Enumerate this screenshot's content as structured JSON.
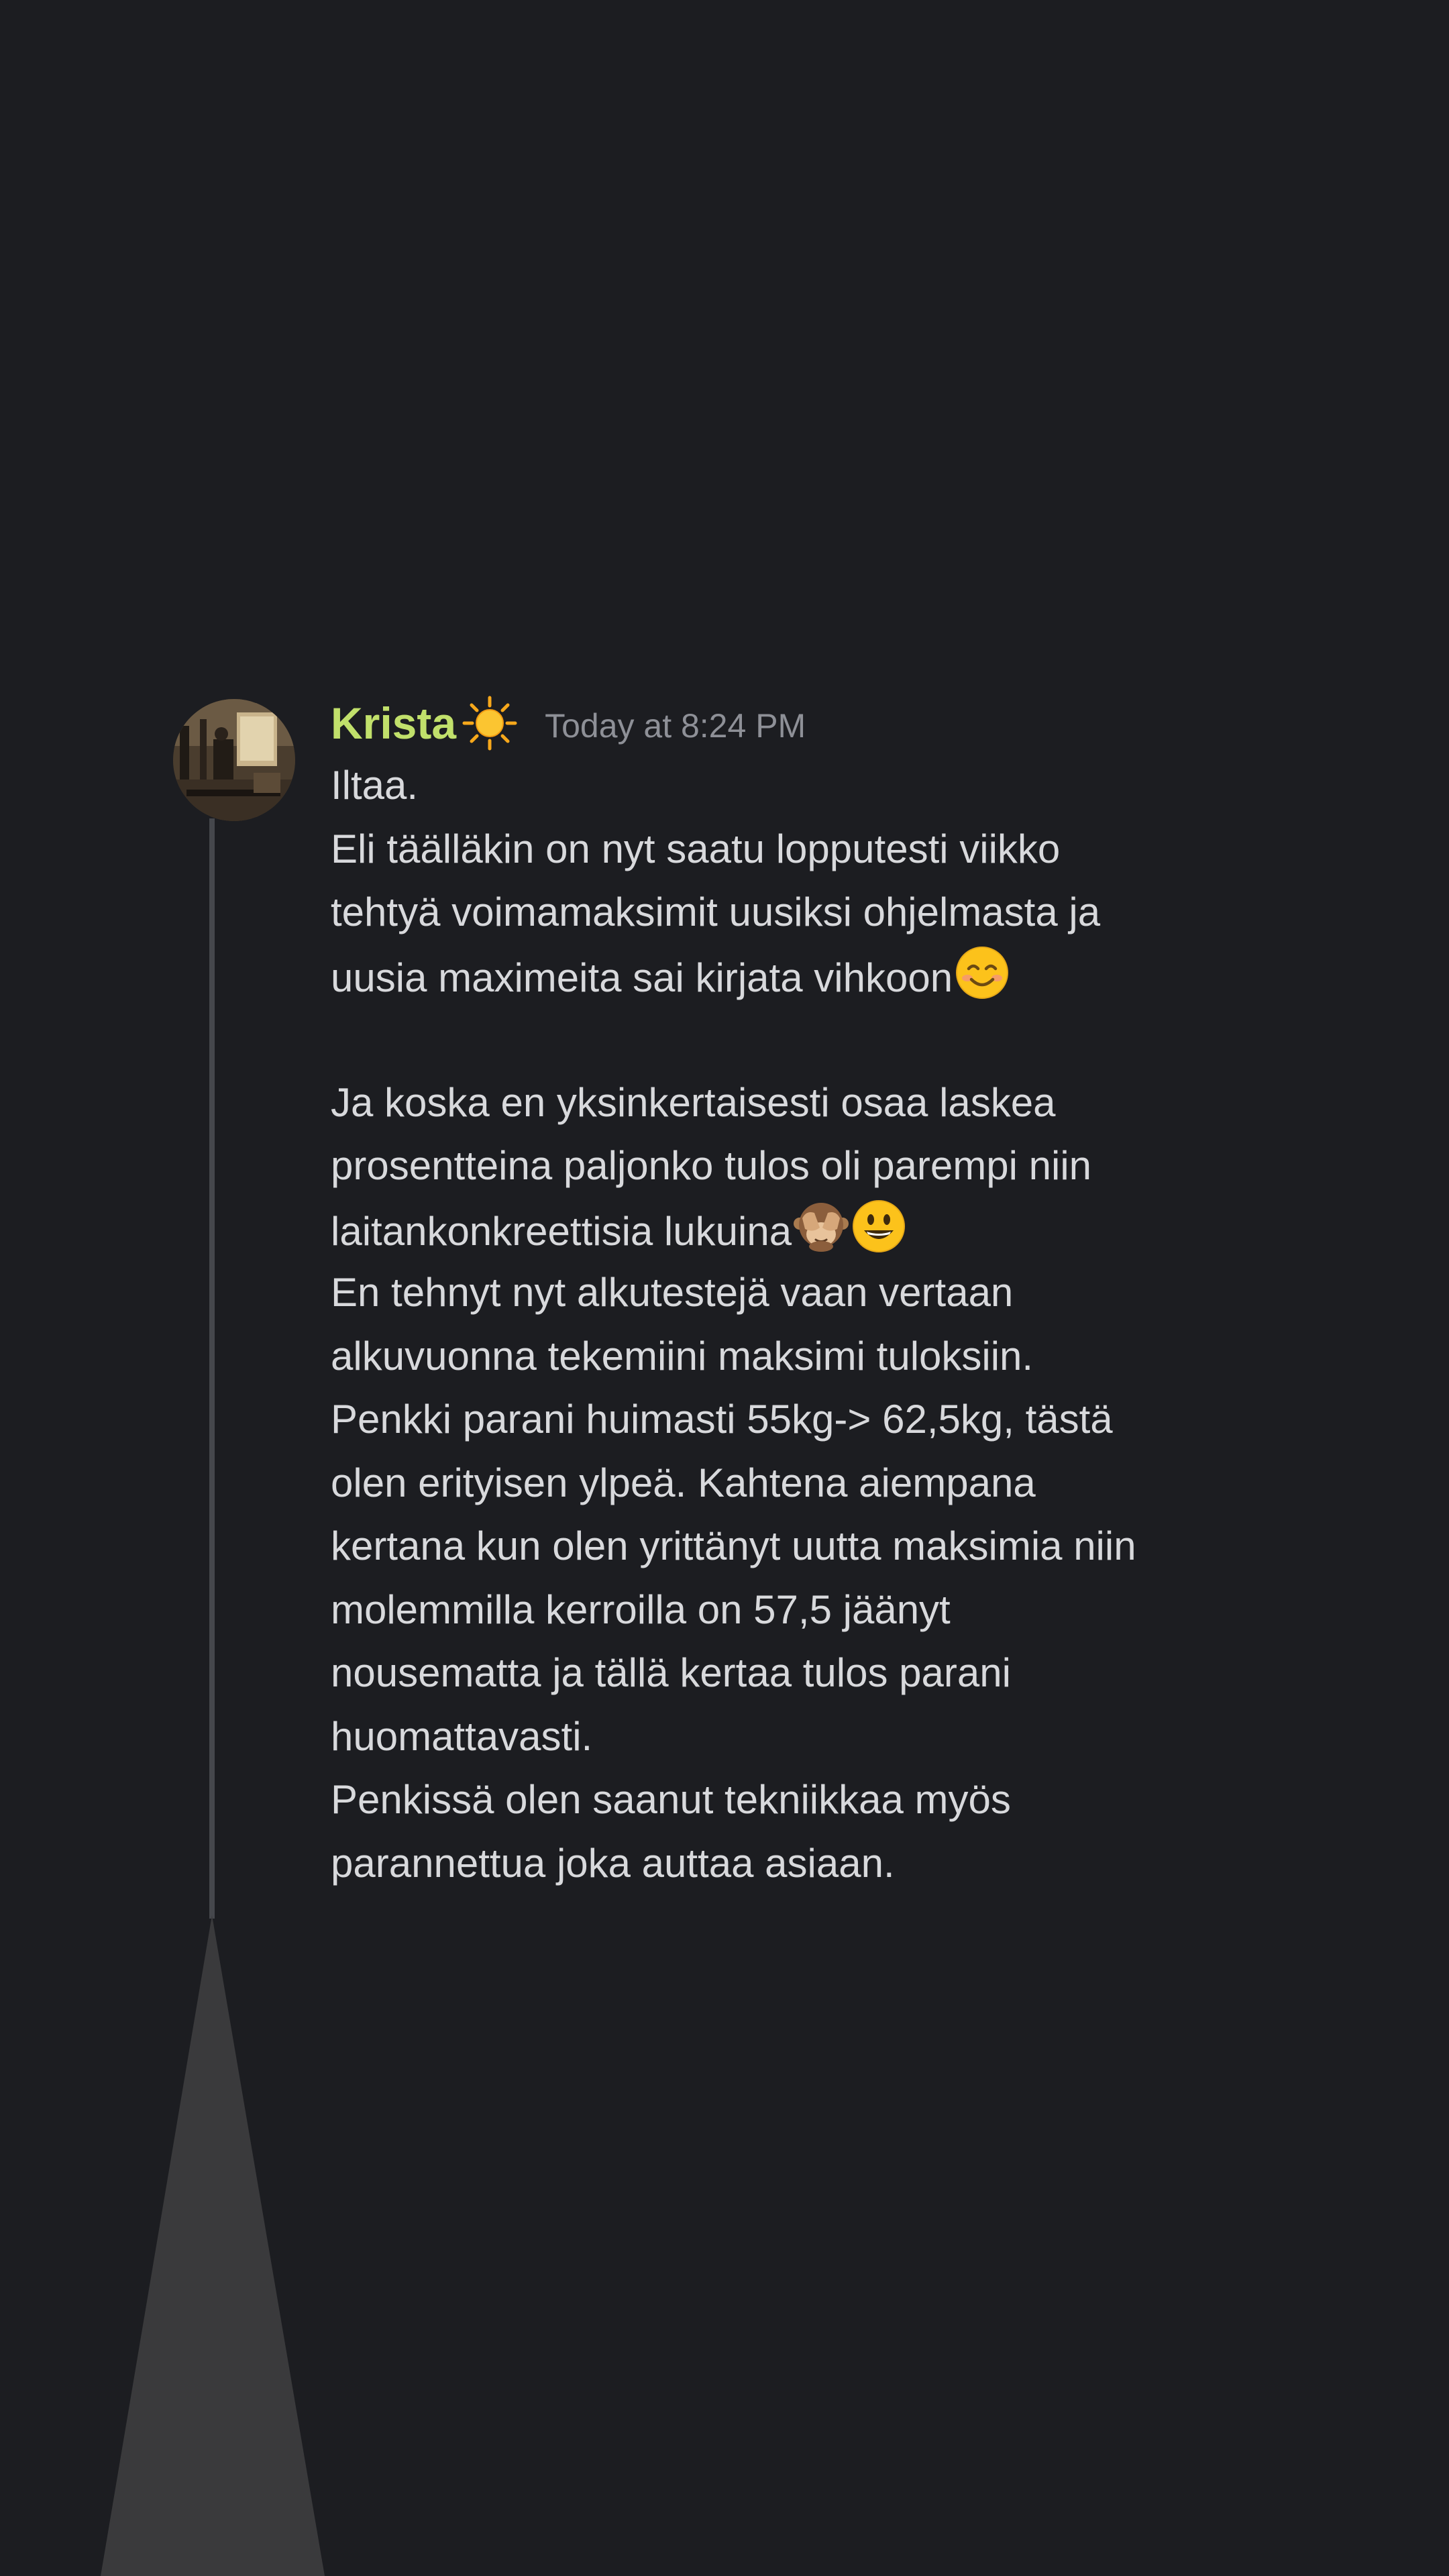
{
  "message": {
    "author": {
      "name": "Krista",
      "name_color": "#c1e06b",
      "name_emoji": "sun-icon",
      "avatar": "gym-photo-avatar"
    },
    "timestamp": "Today at 8:24 PM",
    "lines": [
      "Iltaa.",
      "Eli täälläkin on nyt saatu lopputesti viikko",
      "tehtyä voimamaksimit uusiksi ohjelmasta ja",
      "uusia maximeita sai kirjata vihkoon",
      "",
      "Ja koska en yksinkertaisesti osaa laskea",
      "prosentteina paljonko tulos oli parempi niin",
      "laitankonkreettisia lukuina",
      "En tehnyt nyt alkutestejä vaan vertaan",
      "alkuvuonna tekemiini maksimi tuloksiin.",
      "Penkki parani huimasti 55kg-> 62,5kg, tästä",
      "olen erityisen ylpeä. Kahtena aiempana",
      "kertana kun olen yrittänyt uutta maksimia niin",
      "molemmilla kerroilla on 57,5 jäänyt",
      "nousematta ja tällä kertaa tulos parani",
      "huomattavasti.",
      "Penkissä olen saanut tekniikkaa myös",
      "parannettua joka auttaa asiaan."
    ],
    "inline_emojis": {
      "line_3": [
        "smiling-face-icon"
      ],
      "line_7": [
        "see-no-evil-monkey-icon",
        "grinning-face-icon"
      ]
    }
  },
  "colors": {
    "background": "#1c1d21",
    "text": "#d8d9dc",
    "timestamp": "#8e9097",
    "thread_line": "#45474c"
  }
}
